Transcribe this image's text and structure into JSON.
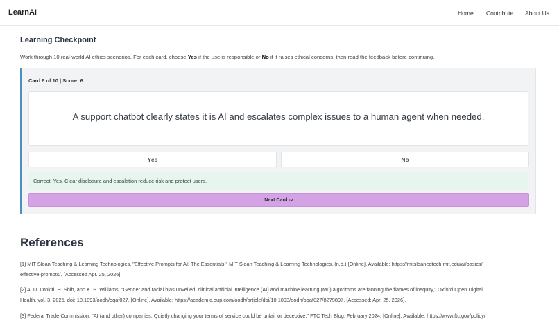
{
  "navbar": {
    "brand": "LearnAI",
    "links": [
      "Home",
      "Contribute",
      "About Us"
    ]
  },
  "checkpoint": {
    "title": "Learning Checkpoint",
    "intro_before_yes": "Work through 10 real-world AI ethics scenarios. For each card, choose ",
    "yes_word": "Yes",
    "intro_between": " if the use is responsible or ",
    "no_word": "No",
    "intro_after_no": " if it raises ethical concerns, then read the feedback before continuing.",
    "status": "Card 6 of 10 | Score: 6",
    "card_text": "A support chatbot clearly states it is AI and escalates complex issues to a human agent when needed.",
    "yes_label": "Yes",
    "no_label": "No",
    "feedback": "Correct. Yes. Clear disclosure and escalation reduce risk and protect users.",
    "next_label": "Next Card ->"
  },
  "colors": {
    "accent_border": "#4a90c2",
    "feedback_bg": "#e6f5ee",
    "next_button_bg": "#d3a3e6"
  },
  "references": {
    "title": "References",
    "lines": [
      "[1] MIT Sloan Teaching & Learning Technologies, \"Effective Prompts for AI: The Essentials,\" MIT Sloan Teaching & Learning Technologies. (n.d.) [Online]. Available: https://mitsloanedtech.mit.edu/ai/basics/",
      "effective-prompts/. [Accessed Apr. 25, 2026].",
      "[2] A. U. Otokiti, H. Shih, and K. S. Williams, \"Gender and racial bias unveiled: clinical artificial intelligence (AI) and machine learning (ML) algorithms are fanning the flames of inequity,\" Oxford Open Digital",
      "Health, vol. 3, 2025, doi: 10.1093/oodh/oqaf027. [Online]. Available: https://academic.oup.com/oodh/article/doi/10.1093/oodh/oqaf027/8279897. [Accessed: Apr. 25, 2026].",
      "[3] Federal Trade Commission, \"AI (and other) companies: Quietly changing your terms of service could be unfair or deceptive,\" FTC Tech Blog, February 2024. [Online]. Available: https://www.ftc.gov/policy/"
    ]
  }
}
